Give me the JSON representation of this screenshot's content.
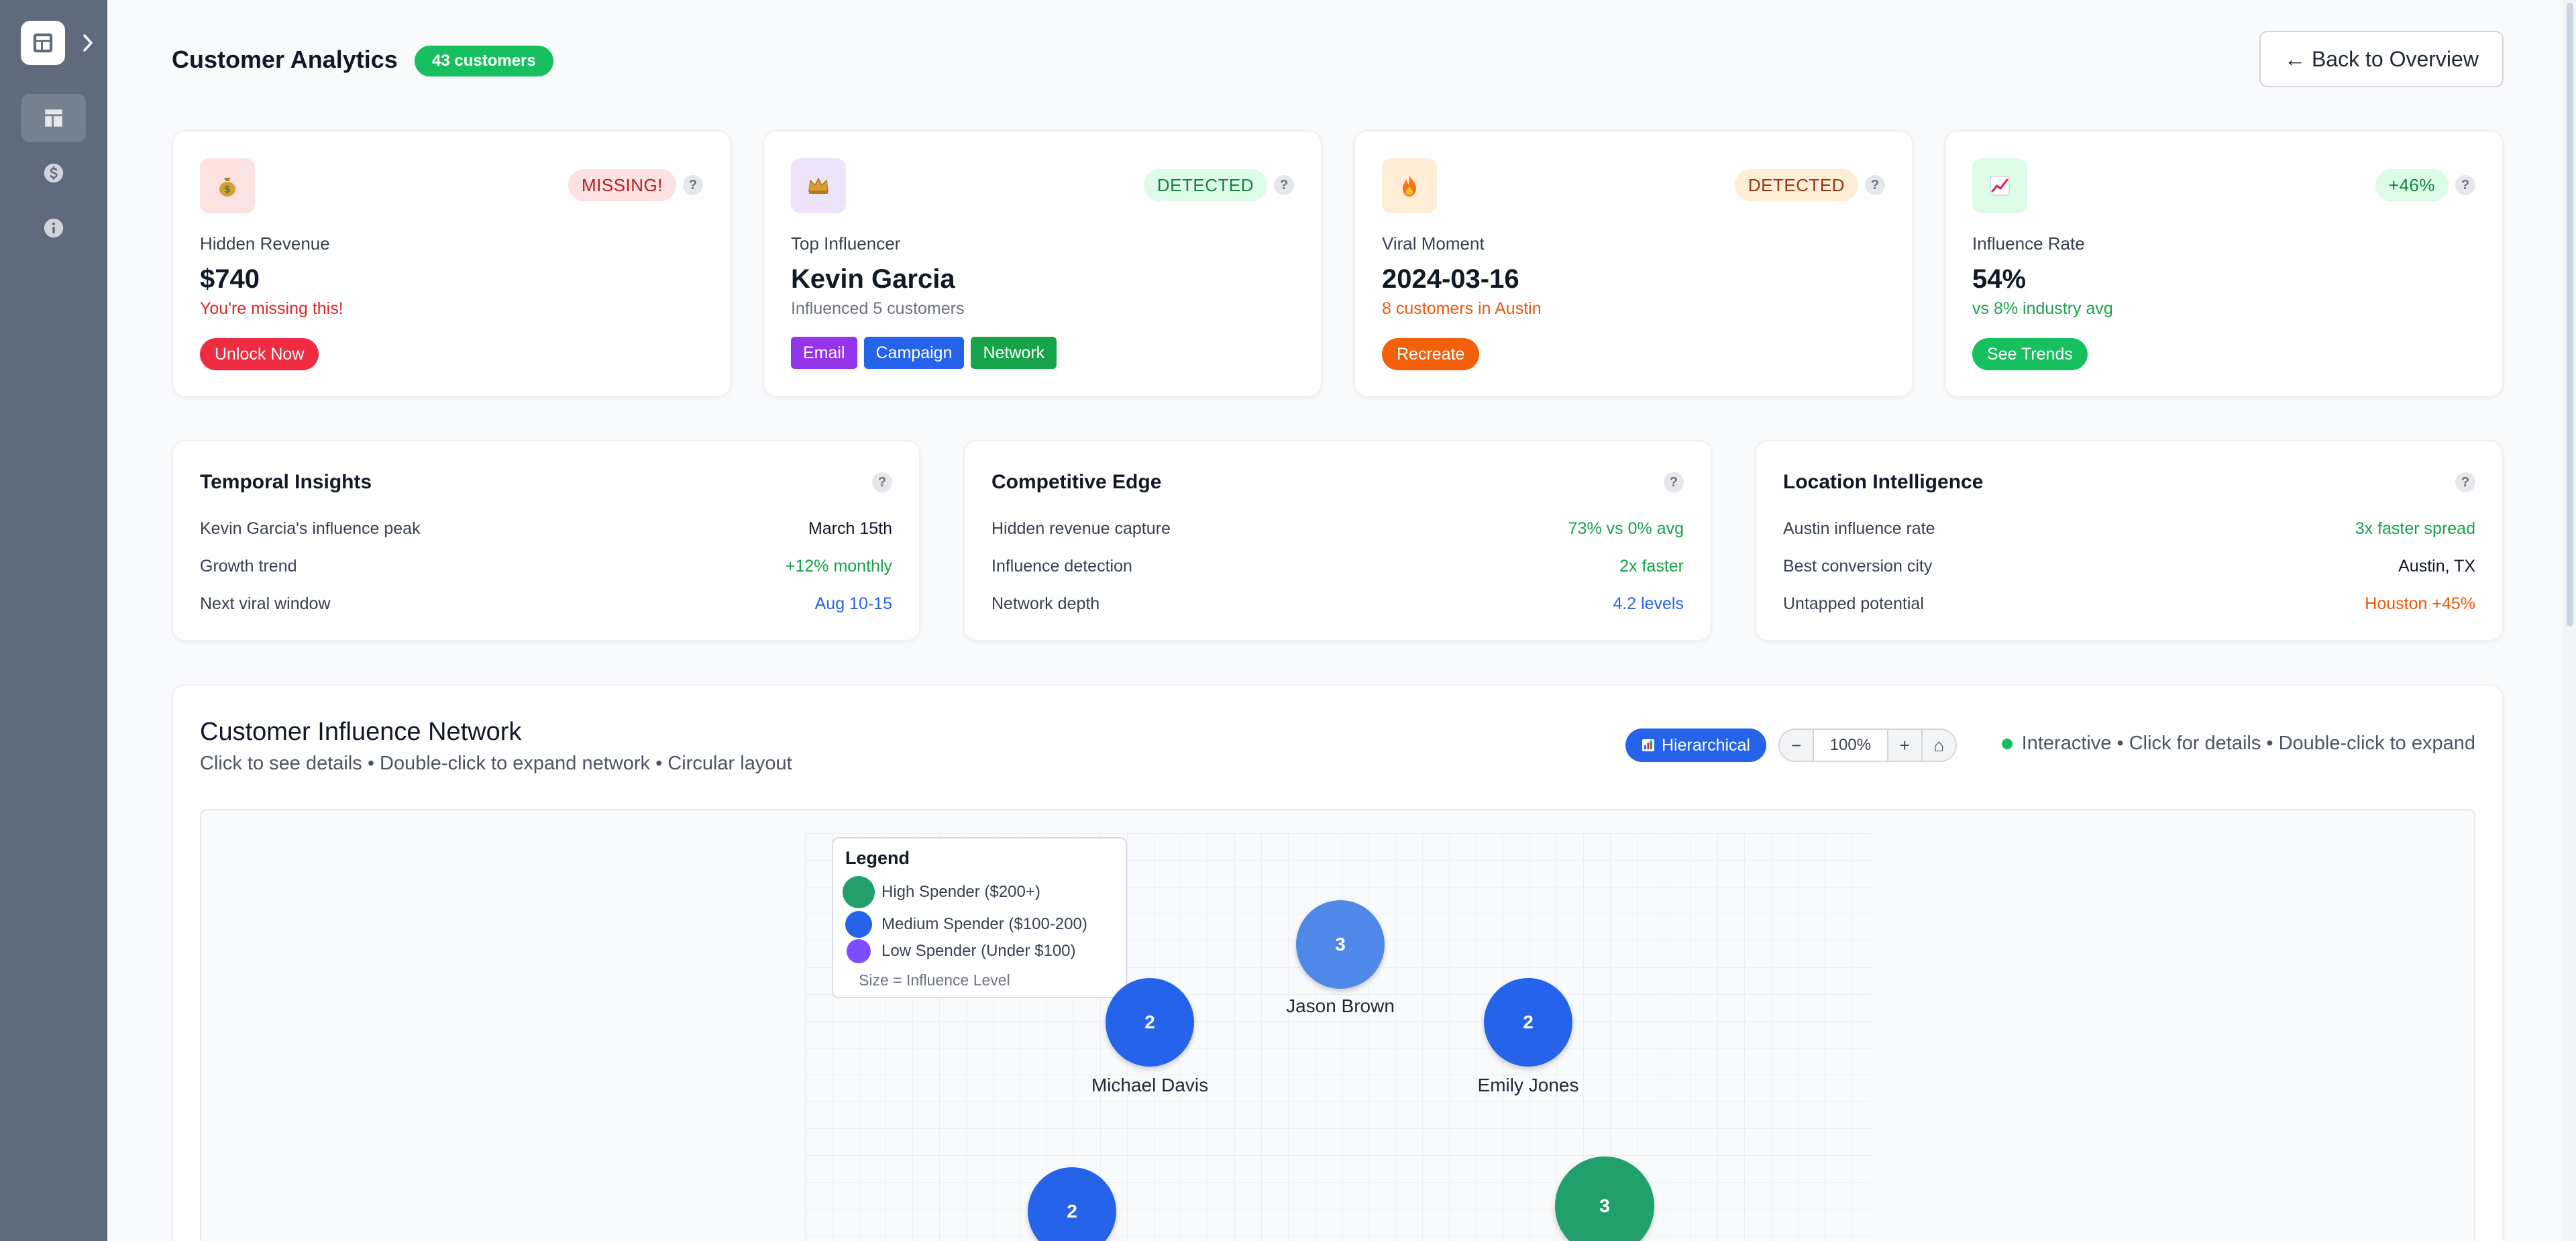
{
  "header": {
    "title": "Customer Analytics",
    "customer_badge": "43 customers",
    "back_label": "← Back to Overview"
  },
  "stat_cards": [
    {
      "icon": "money-bag-icon",
      "status": "MISSING!",
      "label": "Hidden Revenue",
      "value": "$740",
      "sub": "You're missing this!",
      "action": "Unlock Now"
    },
    {
      "icon": "crown-icon",
      "status": "DETECTED",
      "label": "Top Influencer",
      "value": "Kevin Garcia",
      "sub": "Influenced 5 customers",
      "tags": [
        "Email",
        "Campaign",
        "Network"
      ]
    },
    {
      "icon": "fire-icon",
      "status": "DETECTED",
      "label": "Viral Moment",
      "value": "2024-03-16",
      "sub": "8 customers in Austin",
      "action": "Recreate"
    },
    {
      "icon": "chart-increasing-icon",
      "status": "+46%",
      "label": "Influence Rate",
      "value": "54%",
      "sub": "vs 8% industry avg",
      "action": "See Trends"
    }
  ],
  "help_glyph": "?",
  "insights": [
    {
      "title": "Temporal Insights",
      "rows": [
        {
          "k": "Kevin Garcia's influence peak",
          "v": "March 15th"
        },
        {
          "k": "Growth trend",
          "v": "+12% monthly"
        },
        {
          "k": "Next viral window",
          "v": "Aug 10-15"
        }
      ]
    },
    {
      "title": "Competitive Edge",
      "rows": [
        {
          "k": "Hidden revenue capture",
          "v": "73% vs 0% avg"
        },
        {
          "k": "Influence detection",
          "v": "2x faster"
        },
        {
          "k": "Network depth",
          "v": "4.2 levels"
        }
      ]
    },
    {
      "title": "Location Intelligence",
      "rows": [
        {
          "k": "Austin influence rate",
          "v": "3x faster spread"
        },
        {
          "k": "Best conversion city",
          "v": "Austin, TX"
        },
        {
          "k": "Untapped potential",
          "v": "Houston +45%"
        }
      ]
    }
  ],
  "network": {
    "title": "Customer Influence Network",
    "subtitle": "Click to see details • Double-click to expand network • Circular layout",
    "layout_button": "Hierarchical",
    "zoom": {
      "minus": "−",
      "level": "100%",
      "plus": "+",
      "home": "⌂"
    },
    "hint": "Interactive • Click for details • Double-click to expand",
    "legend": {
      "title": "Legend",
      "items": [
        "High Spender ($200+)",
        "Medium Spender ($100-200)",
        "Low Spender (Under $100)"
      ],
      "note": "Size = Influence Level"
    },
    "nodes": [
      {
        "value": "3",
        "label": "Jason Brown"
      },
      {
        "value": "2",
        "label": "Michael Davis"
      },
      {
        "value": "2",
        "label": "Emily Jones"
      },
      {
        "value": "2",
        "label": ""
      },
      {
        "value": "3",
        "label": ""
      }
    ]
  },
  "colors": {
    "high_spender": "#22a06b",
    "medium_spender": "#2563eb",
    "low_spender": "#7c4dff",
    "accent_green": "#16c05e"
  }
}
